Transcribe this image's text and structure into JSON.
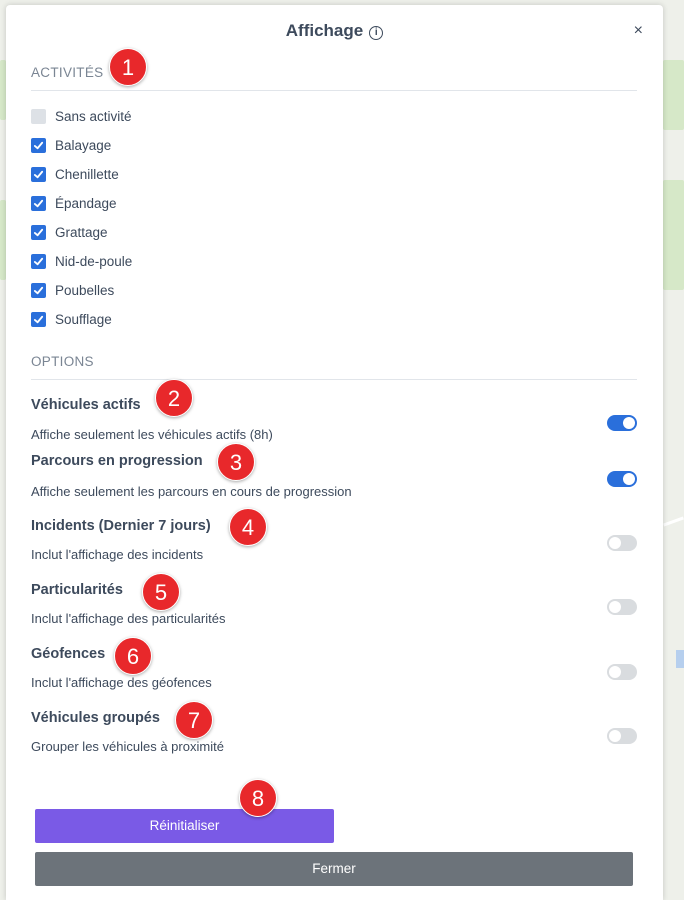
{
  "header": {
    "title": "Affichage",
    "info_icon": "info-icon",
    "close_glyph": "×"
  },
  "activities": {
    "section_title": "ACTIVITÉS",
    "items": [
      {
        "label": "Sans activité",
        "checked": false
      },
      {
        "label": "Balayage",
        "checked": true
      },
      {
        "label": "Chenillette",
        "checked": true
      },
      {
        "label": "Épandage",
        "checked": true
      },
      {
        "label": "Grattage",
        "checked": true
      },
      {
        "label": "Nid-de-poule",
        "checked": true
      },
      {
        "label": "Poubelles",
        "checked": true
      },
      {
        "label": "Soufflage",
        "checked": true
      }
    ]
  },
  "options": {
    "section_title": "OPTIONS",
    "items": [
      {
        "title": "Véhicules actifs",
        "desc": "Affiche seulement les véhicules actifs (8h)",
        "on": true
      },
      {
        "title": "Parcours en progression",
        "desc": "Affiche seulement les parcours en cours de progression",
        "on": true
      },
      {
        "title": "Incidents (Dernier 7 jours)",
        "desc": "Inclut l'affichage des incidents",
        "on": false
      },
      {
        "title": "Particularités",
        "desc": "Inclut l'affichage des particularités",
        "on": false
      },
      {
        "title": "Géofences",
        "desc": "Inclut l'affichage des géofences",
        "on": false
      },
      {
        "title": "Véhicules groupés",
        "desc": "Grouper les véhicules à proximité",
        "on": false
      }
    ]
  },
  "buttons": {
    "reset_label": "Réinitialiser",
    "close_label": "Fermer"
  },
  "badges": [
    "1",
    "2",
    "3",
    "4",
    "5",
    "6",
    "7",
    "8"
  ],
  "colors": {
    "accent": "#2a6fdb",
    "reset": "#7a5ae6",
    "close": "#6c737a",
    "badge": "#e8282b"
  }
}
